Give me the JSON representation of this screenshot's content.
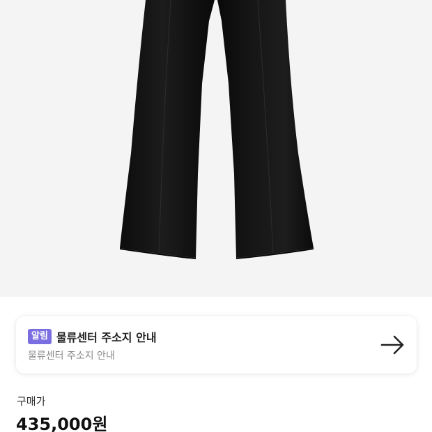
{
  "product": {
    "image_alt": "black flared trousers",
    "image_background": "#f4f4f4",
    "garment_color": "#141414"
  },
  "notice": {
    "badge": "알림",
    "badge_color": "#7b6ee0",
    "title": "물류센터 주소지 안내",
    "subtitle": "물류센터 주소지 안내",
    "action_icon": "arrow-right-icon"
  },
  "price": {
    "label": "구매가",
    "value": "435,000원"
  }
}
